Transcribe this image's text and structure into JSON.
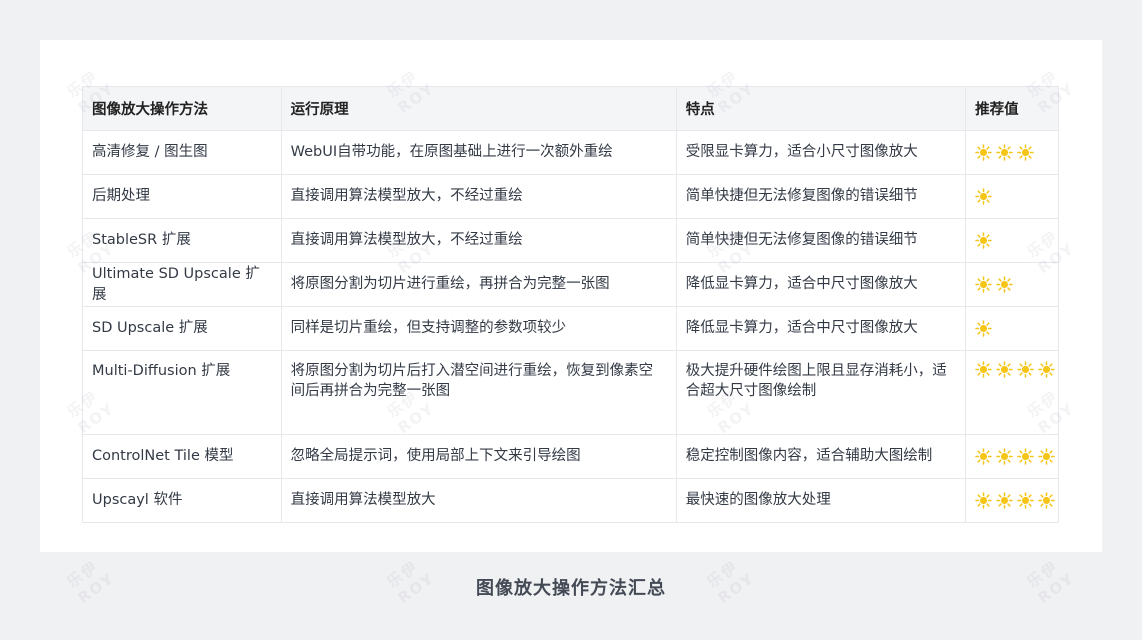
{
  "table": {
    "headers": [
      "图像放大操作方法",
      "运行原理",
      "特点",
      "推荐值"
    ],
    "rows": [
      {
        "method": "高清修复 / 图生图",
        "principle": "WebUI自带功能，在原图基础上进行一次额外重绘",
        "feature": "受限显卡算力，适合小尺寸图像放大",
        "rating": 3
      },
      {
        "method": "后期处理",
        "principle": "直接调用算法模型放大，不经过重绘",
        "feature": "简单快捷但无法修复图像的错误细节",
        "rating": 1
      },
      {
        "method": "StableSR 扩展",
        "principle": "直接调用算法模型放大，不经过重绘",
        "feature": "简单快捷但无法修复图像的错误细节",
        "rating": 1
      },
      {
        "method": "Ultimate SD Upscale 扩展",
        "principle": "将原图分割为切片进行重绘，再拼合为完整一张图",
        "feature": "降低显卡算力，适合中尺寸图像放大",
        "rating": 2
      },
      {
        "method": "SD Upscale 扩展",
        "principle": "同样是切片重绘，但支持调整的参数项较少",
        "feature": "降低显卡算力，适合中尺寸图像放大",
        "rating": 1
      },
      {
        "method": "Multi-Diffusion 扩展",
        "principle": "将原图分割为切片后打入潜空间进行重绘，恢复到像素空间后再拼合为完整一张图",
        "feature": "极大提升硬件绘图上限且显存消耗小，适合超大尺寸图像绘制",
        "rating": 4
      },
      {
        "method": "ControlNet Tile 模型",
        "principle": "忽略全局提示词，使用局部上下文来引导绘图",
        "feature": "稳定控制图像内容，适合辅助大图绘制",
        "rating": 4
      },
      {
        "method": "Upscayl 软件",
        "principle": "直接调用算法模型放大",
        "feature": "最快速的图像放大处理",
        "rating": 4
      }
    ]
  },
  "caption": "图像放大操作方法汇总",
  "icons": {
    "rating": "sun-icon"
  },
  "colors": {
    "sun": "#f5c518",
    "header_bg": "#f4f5f7",
    "border": "#e6e8ec"
  },
  "watermark": {
    "line1": "乐伊",
    "line2": "ROY"
  }
}
